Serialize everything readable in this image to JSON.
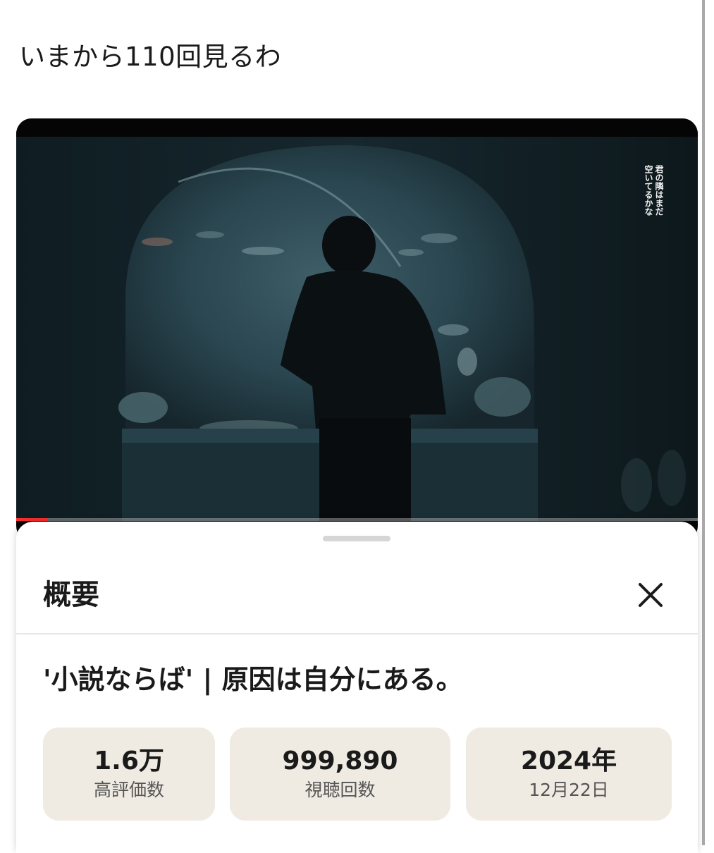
{
  "post": {
    "text": "いまから110回見るわ"
  },
  "video": {
    "overlay_text_line1": "君の隣はまだ",
    "overlay_text_line2": "空いてるかな",
    "progress": 0.045,
    "progress_color": "#ff2d2d"
  },
  "sheet": {
    "title": "概要",
    "close_icon": "close-icon",
    "video_title": "'小説ならば' | 原因は自分にある。",
    "stats": {
      "likes_value": "1.6万",
      "likes_label": "高評価数",
      "views_value": "999,890",
      "views_label": "視聴回数",
      "year_value": "2024年",
      "date_label": "12月22日"
    }
  },
  "colors": {
    "stat_background": "#efeae2",
    "accent_red": "#ff2d2d"
  }
}
